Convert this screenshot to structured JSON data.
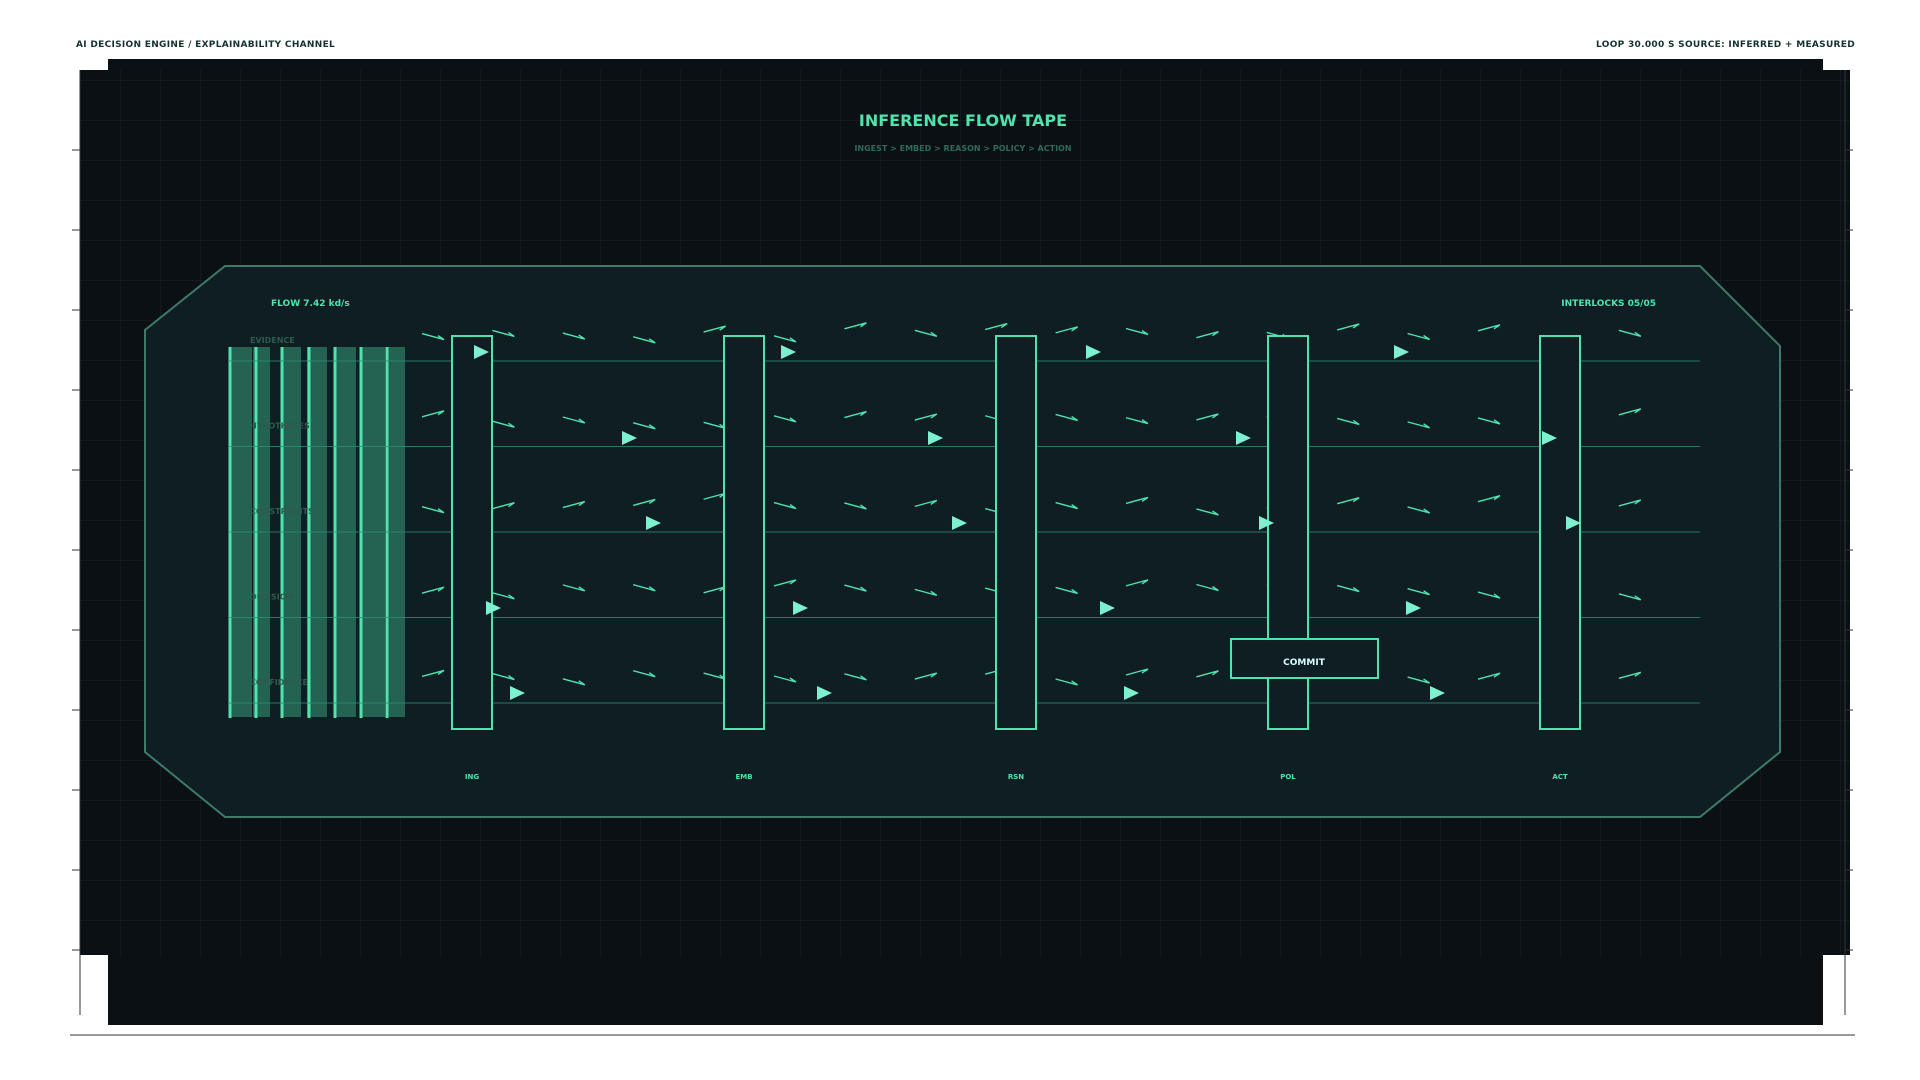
{
  "header": {
    "left_text": "AI DECISION ENGINE / EXPLAINABILITY CHANNEL",
    "right_text": "LOOP 30.000 S   SOURCE: INFERRED + MEASURED"
  },
  "panel": {
    "title": "INFERENCE FLOW TAPE",
    "subtitle": "INGEST > EMBED > REASON > POLICY > ACTION",
    "flow_readout": "FLOW 7.42 kd/s",
    "interlocks_readout": "INTERLOCKS 05/05",
    "commit_label": "COMMIT"
  },
  "lanes": [
    {
      "label": "EVIDENCE"
    },
    {
      "label": "HYPOTHESES"
    },
    {
      "label": "CONSTRAINTS"
    },
    {
      "label": "DECISION"
    },
    {
      "label": "CONFIDENCE"
    }
  ],
  "stages": [
    {
      "label": "ING"
    },
    {
      "label": "EMB"
    },
    {
      "label": "RSN"
    },
    {
      "label": "POL"
    },
    {
      "label": "ACT"
    }
  ],
  "colors": {
    "background": "#0a1014",
    "panel_fill": "#0f1e23",
    "panel_stroke": "#3d7a68",
    "accent": "#4fe3ad",
    "accent_dim": "#2c8f70",
    "lane_label": "#2f5a4e",
    "header_text": "#16322e"
  }
}
